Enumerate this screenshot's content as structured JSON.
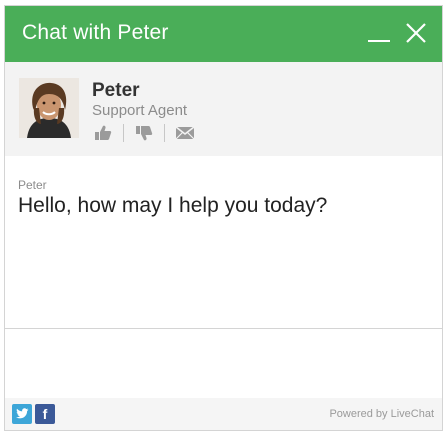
{
  "window": {
    "title": "Chat with Peter"
  },
  "colors": {
    "header": "#4aae58",
    "twitter": "#3da6d8",
    "facebook": "#3b5998"
  },
  "titlebar": {
    "minimize_icon": "minimize-icon",
    "close_icon": "close-icon"
  },
  "agent": {
    "name": "Peter",
    "role": "Support Agent",
    "actions": [
      "thumbs-up-icon",
      "thumbs-down-icon",
      "email-icon"
    ]
  },
  "messages": [
    {
      "author": "Peter",
      "text": "Hello, how may I help you today?"
    }
  ],
  "input": {
    "value": ""
  },
  "footer": {
    "social": [
      "twitter-icon",
      "facebook-icon"
    ],
    "facebook_glyph": "f",
    "powered_by": "Powered by LiveChat"
  }
}
